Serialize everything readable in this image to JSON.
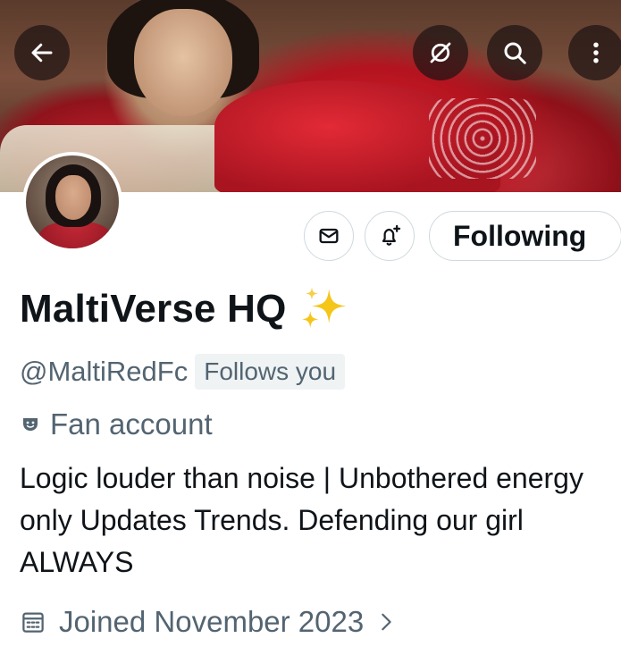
{
  "header": {
    "back_icon": "back-arrow-icon",
    "translate_icon": "translate-off-icon",
    "search_icon": "search-icon",
    "more_icon": "more-vertical-icon"
  },
  "actions": {
    "message_icon": "envelope-icon",
    "notify_icon": "bell-plus-icon",
    "follow_label": "Following"
  },
  "profile": {
    "display_name": "MaltiVerse HQ",
    "name_emoji": "sparkles-icon",
    "handle": "@MaltiRedFc",
    "follows_you": "Follows you",
    "category_icon": "theater-mask-icon",
    "category": "Fan account",
    "bio": "Logic louder than noise |  Unbothered energy only Updates Trends. Defending our girl ALWAYS",
    "joined_icon": "calendar-icon",
    "joined": "Joined November 2023"
  },
  "colors": {
    "primary_text": "#0f1419",
    "secondary_text": "#536471",
    "border": "#cfd9de",
    "badge_bg": "#eff3f4",
    "sparkle": "#f5c518"
  }
}
